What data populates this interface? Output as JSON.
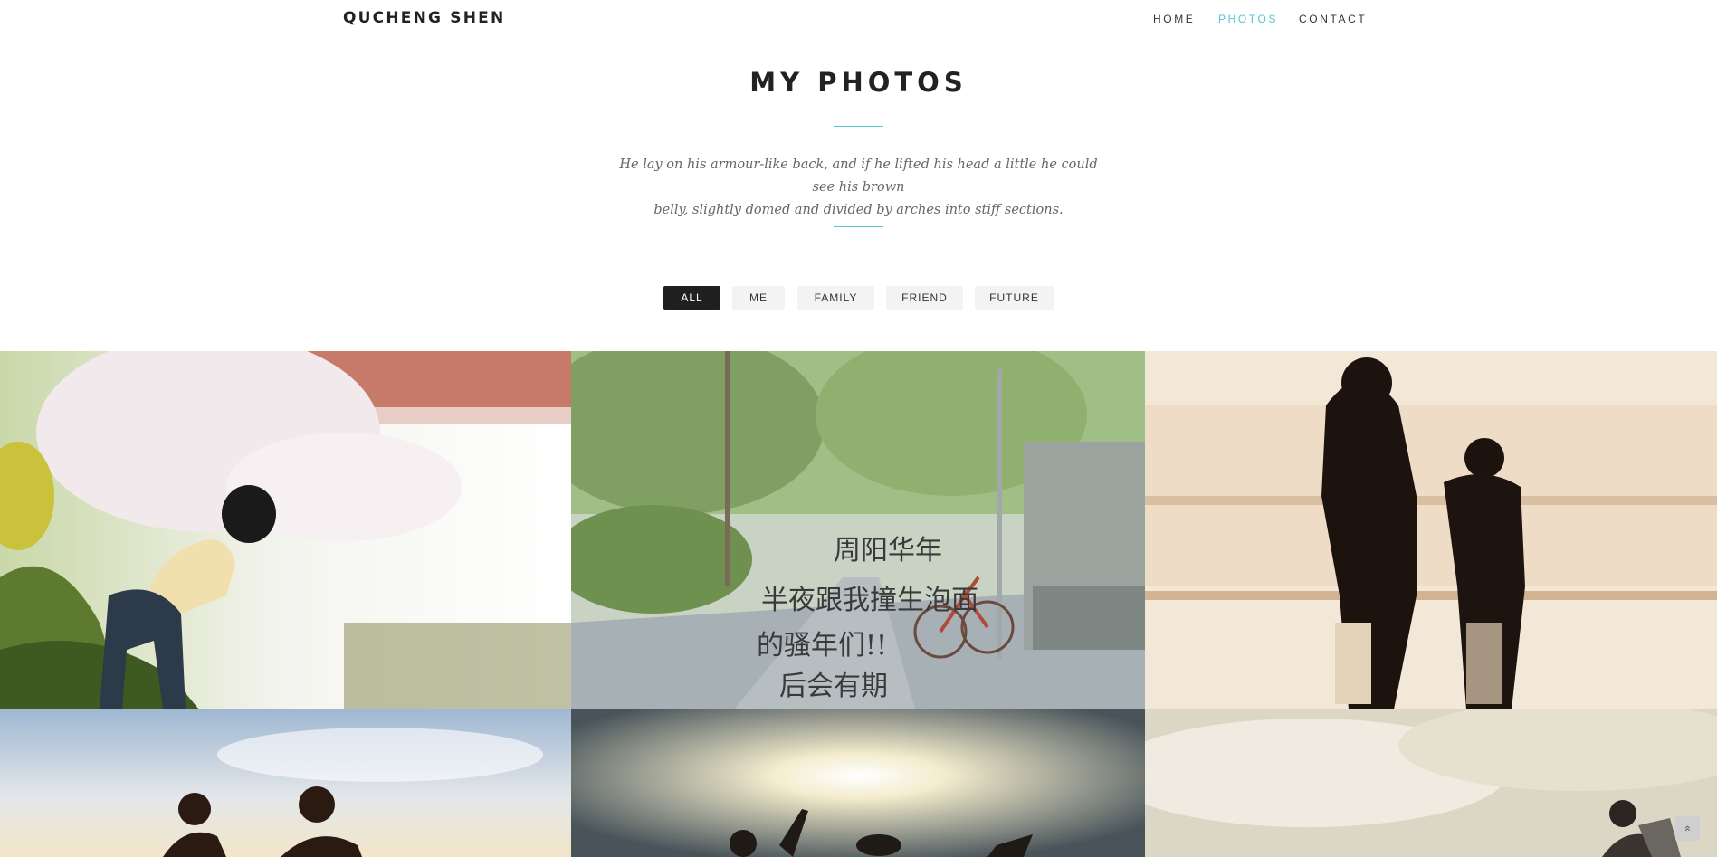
{
  "header": {
    "brand": "QUCHENG SHEN",
    "nav": [
      {
        "label": "HOME",
        "active": false
      },
      {
        "label": "PHOTOS",
        "active": true
      },
      {
        "label": "CONTACT",
        "active": false
      }
    ]
  },
  "main": {
    "title": "MY PHOTOS",
    "intro_line1": "He lay on his armour-like back, and if he lifted his head a little he could see his brown",
    "intro_line2": "belly, slightly domed and divided by arches into stiff sections."
  },
  "filters": [
    {
      "label": "ALL",
      "active": true
    },
    {
      "label": "ME",
      "active": false
    },
    {
      "label": "FAMILY",
      "active": false
    },
    {
      "label": "FRIEND",
      "active": false
    },
    {
      "label": "FUTURE",
      "active": false
    }
  ],
  "photo2_text": [
    "周阳华年",
    "半夜跟我撞生泡面",
    "的骚年们!!",
    "后会有期"
  ],
  "colors": {
    "accent": "#53c6d6",
    "dark_button": "#1f1f1f",
    "light_button": "#f3f3f3"
  },
  "icons": {
    "scroll_top": "double-chevron-up-icon"
  }
}
